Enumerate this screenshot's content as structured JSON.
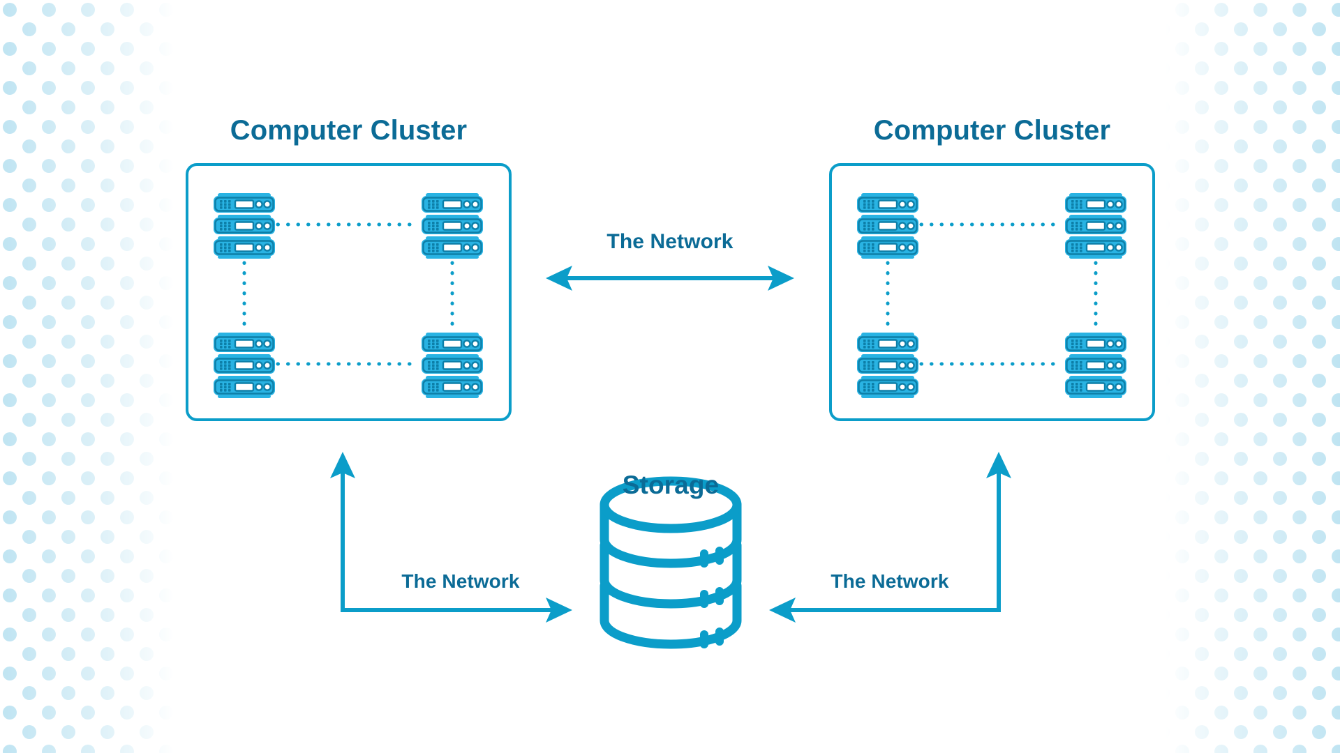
{
  "diagram": {
    "title_text_color": "#0b6b96",
    "accent_color": "#0b9dc9",
    "server_body_color": "#29b3e3",
    "server_detail_color": "#0d7fa8",
    "background_color": "#ffffff",
    "halftone_dot_color": "#d8eef7",
    "clusters": [
      {
        "id": "cluster-left",
        "title": "Computer Cluster",
        "server_count": 4,
        "servers": [
          {
            "position": "top-left",
            "units": 3
          },
          {
            "position": "top-right",
            "units": 3
          },
          {
            "position": "bottom-left",
            "units": 3
          },
          {
            "position": "bottom-right",
            "units": 3
          }
        ],
        "internal_links": [
          "top-left—top-right",
          "bottom-left—bottom-right",
          "top-left—bottom-left",
          "top-right—bottom-right"
        ],
        "link_style": "dotted"
      },
      {
        "id": "cluster-right",
        "title": "Computer Cluster",
        "server_count": 4,
        "servers": [
          {
            "position": "top-left",
            "units": 3
          },
          {
            "position": "top-right",
            "units": 3
          },
          {
            "position": "bottom-left",
            "units": 3
          },
          {
            "position": "bottom-right",
            "units": 3
          }
        ],
        "internal_links": [
          "top-left—top-right",
          "bottom-left—bottom-right",
          "top-left—bottom-left",
          "top-right—bottom-right"
        ],
        "link_style": "dotted"
      }
    ],
    "storage": {
      "title": "Storage",
      "icon": "database-cylinder",
      "bands": 3,
      "indicators_per_band": 2
    },
    "connections": [
      {
        "id": "cluster-to-cluster",
        "label": "The Network",
        "from": "cluster-left",
        "to": "cluster-right",
        "arrow": "bidirectional",
        "orientation": "horizontal"
      },
      {
        "id": "left-cluster-to-storage",
        "label": "The Network",
        "from": "cluster-left",
        "to": "storage",
        "arrow": "bidirectional",
        "orientation": "elbow-up-right"
      },
      {
        "id": "right-cluster-to-storage",
        "label": "The Network",
        "from": "cluster-right",
        "to": "storage",
        "arrow": "bidirectional",
        "orientation": "elbow-up-left"
      }
    ]
  }
}
